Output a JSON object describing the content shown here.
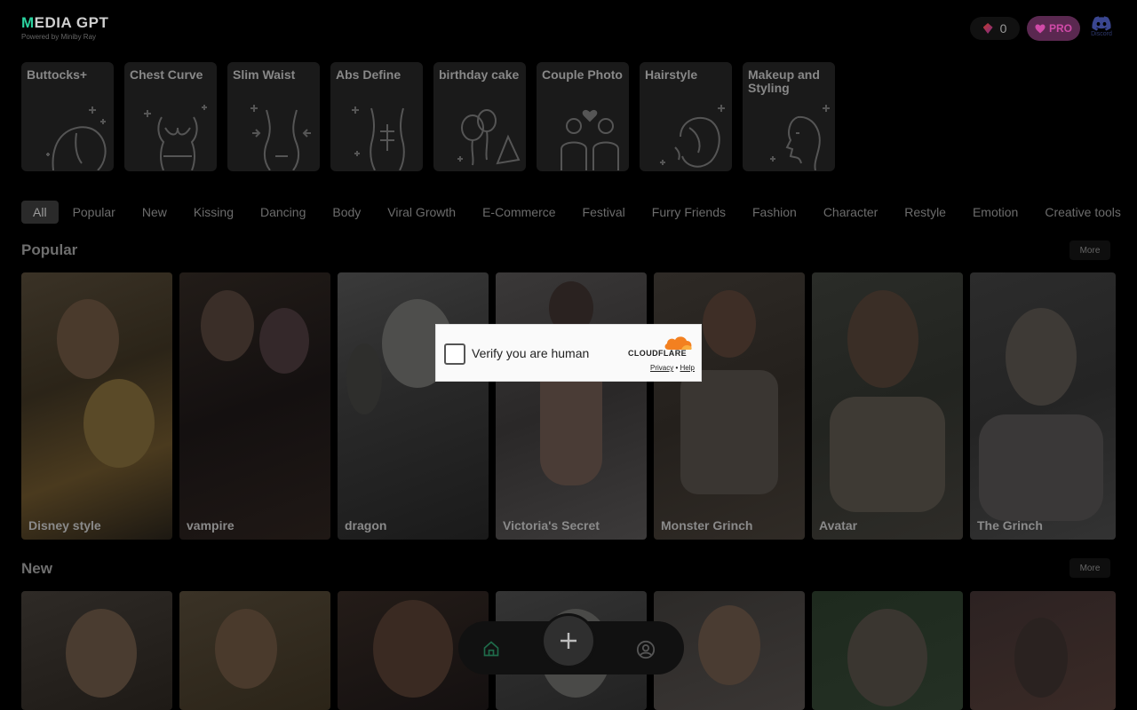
{
  "header": {
    "logo_first_letter": "M",
    "logo_rest": "EDIA GPT",
    "logo_subtitle": "Powered by Miniby Ray",
    "credits": "0",
    "pro_label": "PRO",
    "discord_label": "Discord"
  },
  "quick_tools": [
    {
      "label": "Buttocks+",
      "icon": "buttocks-icon"
    },
    {
      "label": "Chest Curve",
      "icon": "chest-icon"
    },
    {
      "label": "Slim Waist",
      "icon": "waist-icon"
    },
    {
      "label": "Abs Define",
      "icon": "abs-icon"
    },
    {
      "label": "birthday cake",
      "icon": "balloons-icon"
    },
    {
      "label": "Couple Photo",
      "icon": "couple-icon"
    },
    {
      "label": "Hairstyle",
      "icon": "hairstyle-icon"
    },
    {
      "label": "Makeup and Styling",
      "icon": "makeup-icon"
    }
  ],
  "tabs": [
    "All",
    "Popular",
    "New",
    "Kissing",
    "Dancing",
    "Body",
    "Viral Growth",
    "E-Commerce",
    "Festival",
    "Furry Friends",
    "Fashion",
    "Character",
    "Restyle",
    "Emotion",
    "Creative tools"
  ],
  "active_tab": "All",
  "sections": {
    "popular": {
      "title": "Popular",
      "more": "More",
      "cards": [
        "Disney style",
        "vampire",
        "dragon",
        "Victoria's Secret",
        "Monster Grinch",
        "Avatar",
        "The Grinch"
      ]
    },
    "new": {
      "title": "New",
      "more": "More"
    }
  },
  "captcha": {
    "text": "Verify you are human",
    "brand": "CLOUDFLARE",
    "privacy": "Privacy",
    "separator": "•",
    "help": "Help"
  },
  "colors": {
    "accent_logo": "#2bd3a0",
    "pro_text": "#d04aa8",
    "cloudflare_orange": "#f38020"
  }
}
